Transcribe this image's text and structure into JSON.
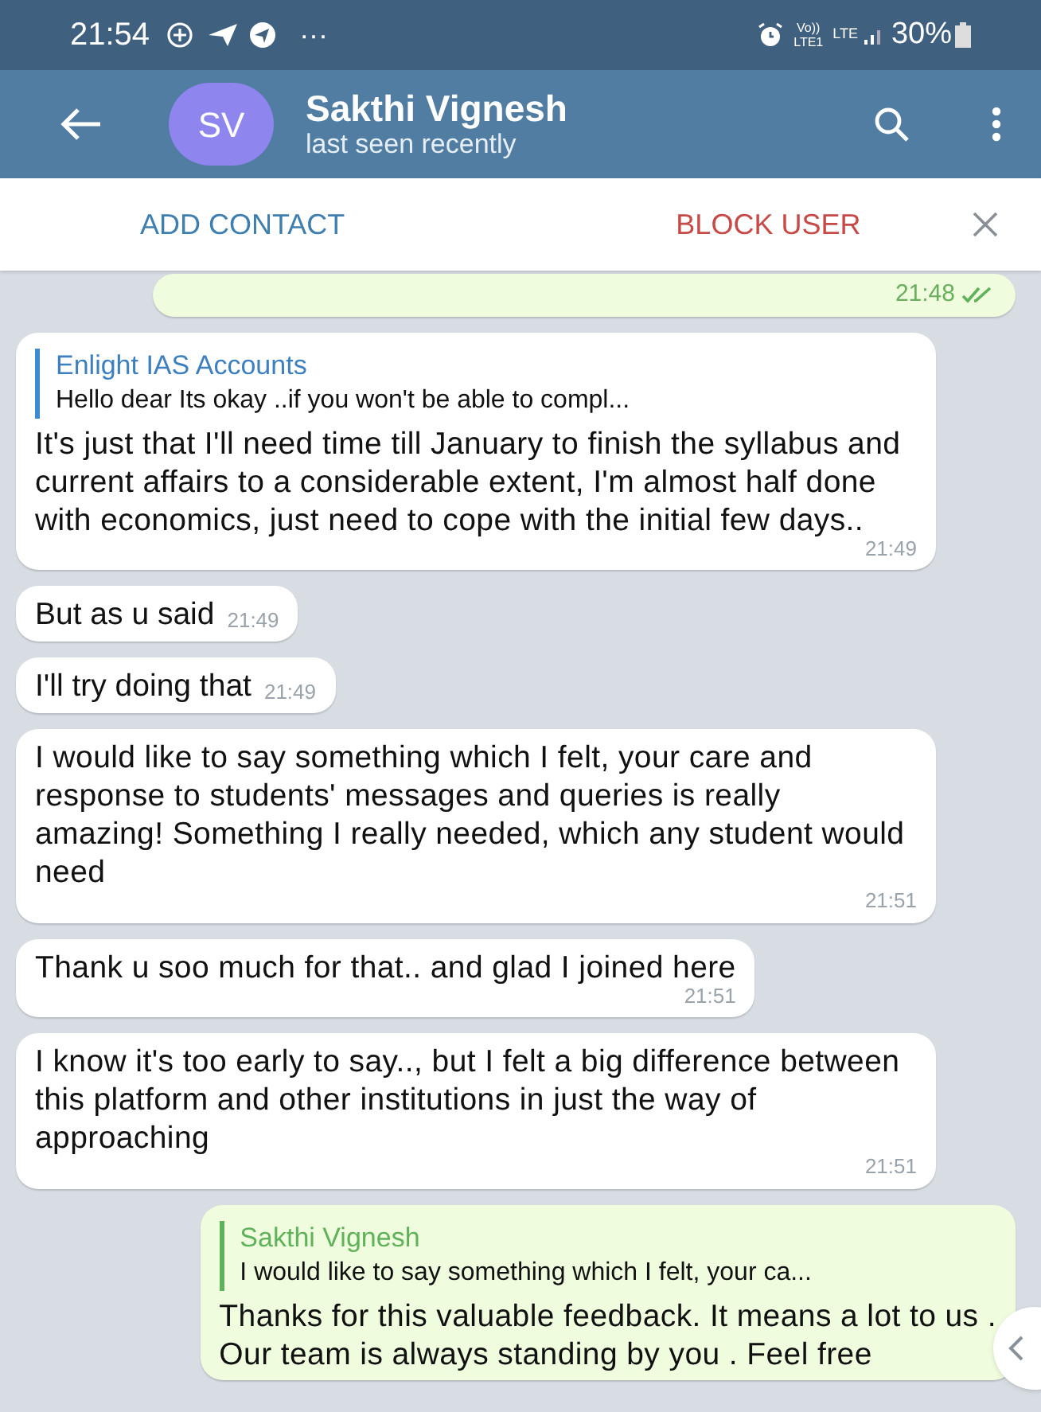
{
  "status_bar": {
    "time": "21:54",
    "more": "···",
    "volte": "Vo))",
    "volte_sub": "LTE1",
    "network": "LTE",
    "battery": "30%"
  },
  "header": {
    "avatar_initials": "SV",
    "name": "Sakthi Vignesh",
    "status": "last seen recently"
  },
  "action_bar": {
    "add": "ADD CONTACT",
    "block": "BLOCK USER"
  },
  "messages": [
    {
      "kind": "outgoing",
      "time": "21:48",
      "read": true
    },
    {
      "kind": "incoming",
      "reply": {
        "author": "Enlight IAS Accounts",
        "text": "Hello dear Its okay ..if you won't be able to compl..."
      },
      "text": "It's just that I'll need time till January to finish the syllabus and current affairs to a considerable extent, I'm almost half done with economics, just need to cope with the initial few days..",
      "time": "21:49"
    },
    {
      "kind": "incoming",
      "text": "But as u said",
      "time": "21:49"
    },
    {
      "kind": "incoming",
      "text": "I'll try doing that",
      "time": "21:49"
    },
    {
      "kind": "incoming",
      "text": "I would like to say something which I felt, your care and response to students' messages and queries is really amazing! Something I really needed, which any student would need",
      "time": "21:51"
    },
    {
      "kind": "incoming",
      "text": "Thank u soo much for that.. and glad I joined here",
      "time": "21:51"
    },
    {
      "kind": "incoming",
      "text": "I know it's too early to say.., but I felt a big difference between this platform and other institutions in just the way of approaching",
      "time": "21:51"
    },
    {
      "kind": "outgoing",
      "reply": {
        "author": "Sakthi Vignesh",
        "text": "I would like to say something which I felt, your ca..."
      },
      "text": "Thanks for this valuable feedback. It means a lot to us .\nOur team is always standing by you . Feel free"
    }
  ]
}
